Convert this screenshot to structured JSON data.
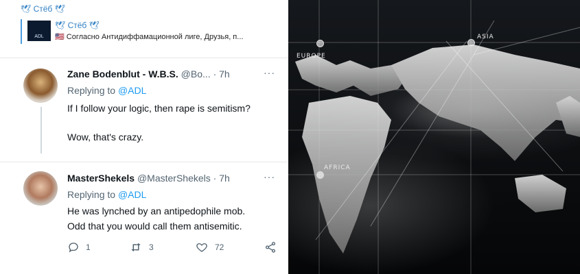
{
  "channel": {
    "title": "🕊 Стёб 🕊"
  },
  "reply": {
    "name": "🕊 Стёб 🕊",
    "thumb_label": "ADL",
    "text": "🇺🇸 Согласно Антидиффамационной лиге, Друзья, п..."
  },
  "map": {
    "labels": [
      "EUROPE",
      "ASIA",
      "AFRICA"
    ]
  },
  "tweets": [
    {
      "name": "Zane Bodenblut - W.B.S.",
      "handle": "@Bo...",
      "time": "· 7h",
      "replying_prefix": "Replying to",
      "replying_to": "@ADL",
      "line1": "If I follow your logic, then rape is semitism?",
      "line2": "Wow, that's crazy."
    },
    {
      "name": "MasterShekels",
      "handle": "@MasterShekels",
      "time": "· 7h",
      "replying_prefix": "Replying to",
      "replying_to": "@ADL",
      "line1": "He was lynched by an antipedophile mob.",
      "line2": "Odd that you would call them antisemitic.",
      "actions": {
        "replies": "1",
        "retweets": "3",
        "likes": "72"
      }
    }
  ],
  "more_icon": "···"
}
